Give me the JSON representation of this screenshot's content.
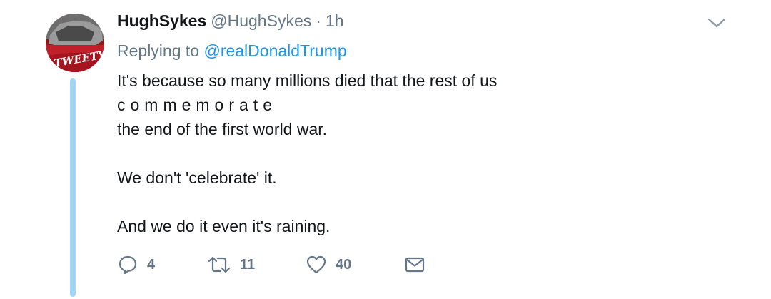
{
  "author": {
    "display_name": "HughSykes",
    "handle": "@HughSykes",
    "separator": "·",
    "time": "1h",
    "avatar_label": "TWEETY"
  },
  "reply": {
    "prefix": "Replying to",
    "mention": "@realDonaldTrump"
  },
  "body": {
    "line1": "It's because so many millions died that the rest of us",
    "line2": "commemorate",
    "line3": "the end of the first world war.",
    "line4": "We don't 'celebrate' it.",
    "line5": "And we do it even it's raining."
  },
  "actions": {
    "replies": "4",
    "retweets": "11",
    "likes": "40"
  },
  "icons": {
    "reply": "reply-icon",
    "retweet": "retweet-icon",
    "like": "heart-icon",
    "dm": "envelope-icon",
    "more": "chevron-down-icon"
  },
  "colors": {
    "link": "#1b95e0",
    "secondary_text": "#657786",
    "thread_line": "#a3d3f5"
  }
}
